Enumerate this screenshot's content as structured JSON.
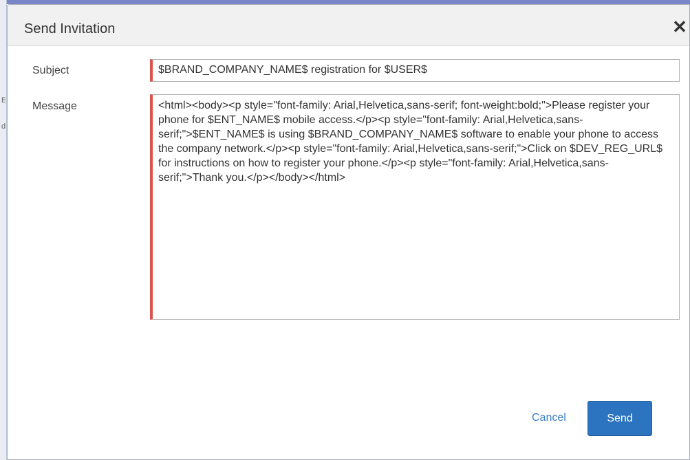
{
  "dialog": {
    "title": "Send Invitation",
    "close_symbol": "✕",
    "close_icon": "close-icon"
  },
  "form": {
    "subject_label": "Subject",
    "subject_value": "$BRAND_COMPANY_NAME$ registration for $USER$",
    "message_label": "Message",
    "message_value": "<html><body><p style=\"font-family: Arial,Helvetica,sans-serif; font-weight:bold;\">Please register your phone for $ENT_NAME$ mobile access.</p><p style=\"font-family: Arial,Helvetica,sans-serif;\">$ENT_NAME$ is using $BRAND_COMPANY_NAME$ software to enable your phone to access the company network.</p><p style=\"font-family: Arial,Helvetica,sans-serif;\">Click on $DEV_REG_URL$ for instructions on how to register your phone.</p><p style=\"font-family: Arial,Helvetica,sans-serif;\">Thank you.</p></body></html>",
    "required_indicator_color": "#d9534f"
  },
  "actions": {
    "cancel_label": "Cancel",
    "send_label": "Send",
    "send_color": "#2d74c0",
    "cancel_color": "#3b7fc4"
  },
  "background": {
    "fragments": [
      "E",
      "d"
    ]
  }
}
